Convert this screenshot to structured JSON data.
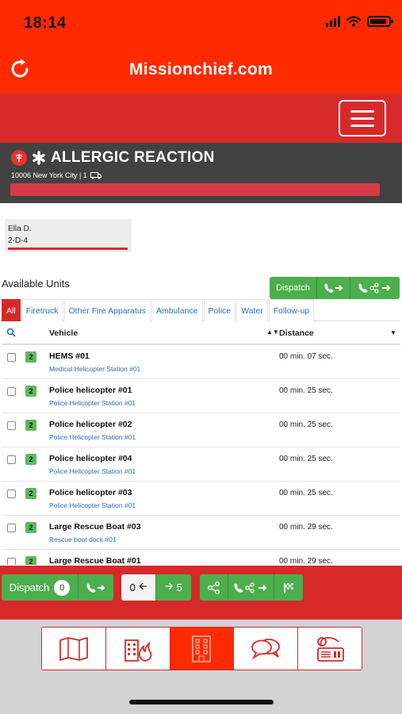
{
  "status_bar": {
    "time": "18:14"
  },
  "app": {
    "title": "Missionchief.com"
  },
  "mission": {
    "title": "ALLERGIC REACTION",
    "location": "10006 New York City | 1"
  },
  "patient": {
    "name": "Ella D.",
    "code": "2-D-4"
  },
  "available_units": {
    "title": "Available Units",
    "dispatch_label": "Dispatch"
  },
  "tabs": [
    "All",
    "Firetruck",
    "Other Fire Apparatus",
    "Ambulance",
    "Police",
    "Water",
    "Follow-up"
  ],
  "table": {
    "headers": {
      "vehicle": "Vehicle",
      "distance": "Distance"
    },
    "rows": [
      {
        "badge": "2",
        "vehicle": "HEMS #01",
        "station": "Medical Helicopter Station #01",
        "distance": "00 min. 07 sec."
      },
      {
        "badge": "2",
        "vehicle": "Police helicopter #01",
        "station": "Police Helicopter Station #01",
        "distance": "00 min. 25 sec."
      },
      {
        "badge": "2",
        "vehicle": "Police helicopter #02",
        "station": "Police Helicopter Station #01",
        "distance": "00 min. 25 sec."
      },
      {
        "badge": "2",
        "vehicle": "Police helicopter #04",
        "station": "Police Helicopter Station #01",
        "distance": "00 min. 25 sec."
      },
      {
        "badge": "2",
        "vehicle": "Police helicopter #03",
        "station": "Police Helicopter Station #01",
        "distance": "00 min. 25 sec."
      },
      {
        "badge": "2",
        "vehicle": "Large Rescue Boat #03",
        "station": "Rescue boat dock #01",
        "distance": "00 min. 29 sec."
      },
      {
        "badge": "2",
        "vehicle": "Large Rescue Boat #01",
        "station": "",
        "distance": "00 min. 29 sec."
      }
    ]
  },
  "bottom_bar": {
    "dispatch_label": "Dispatch",
    "dispatch_count": "0",
    "prev_count": "0",
    "next_count": "5"
  },
  "colors": {
    "brand_red": "#ff2a00",
    "nav_red": "#d8292a",
    "green": "#4cae4c",
    "link_blue": "#2a6fb5"
  },
  "tabbar_icons": [
    "map-icon",
    "fire-building-icon",
    "building-icon",
    "chat-icon",
    "radio-icon"
  ]
}
